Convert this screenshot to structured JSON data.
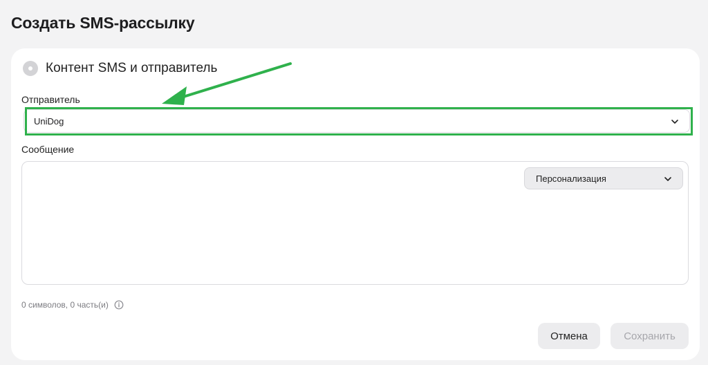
{
  "page": {
    "title": "Создать SMS-рассылку"
  },
  "section": {
    "title": "Контент SMS и отправитель",
    "step_icon": "step-indicator-icon"
  },
  "sender": {
    "label": "Отправитель",
    "value": "UniDog",
    "icon": "chevron-down-icon"
  },
  "message": {
    "label": "Сообщение",
    "personalization_label": "Персонализация",
    "counter": "0 символов, 0 часть(и)"
  },
  "actions": {
    "cancel_label": "Отмена",
    "save_label": "Сохранить"
  },
  "annotation": {
    "color": "#2fb14c"
  }
}
